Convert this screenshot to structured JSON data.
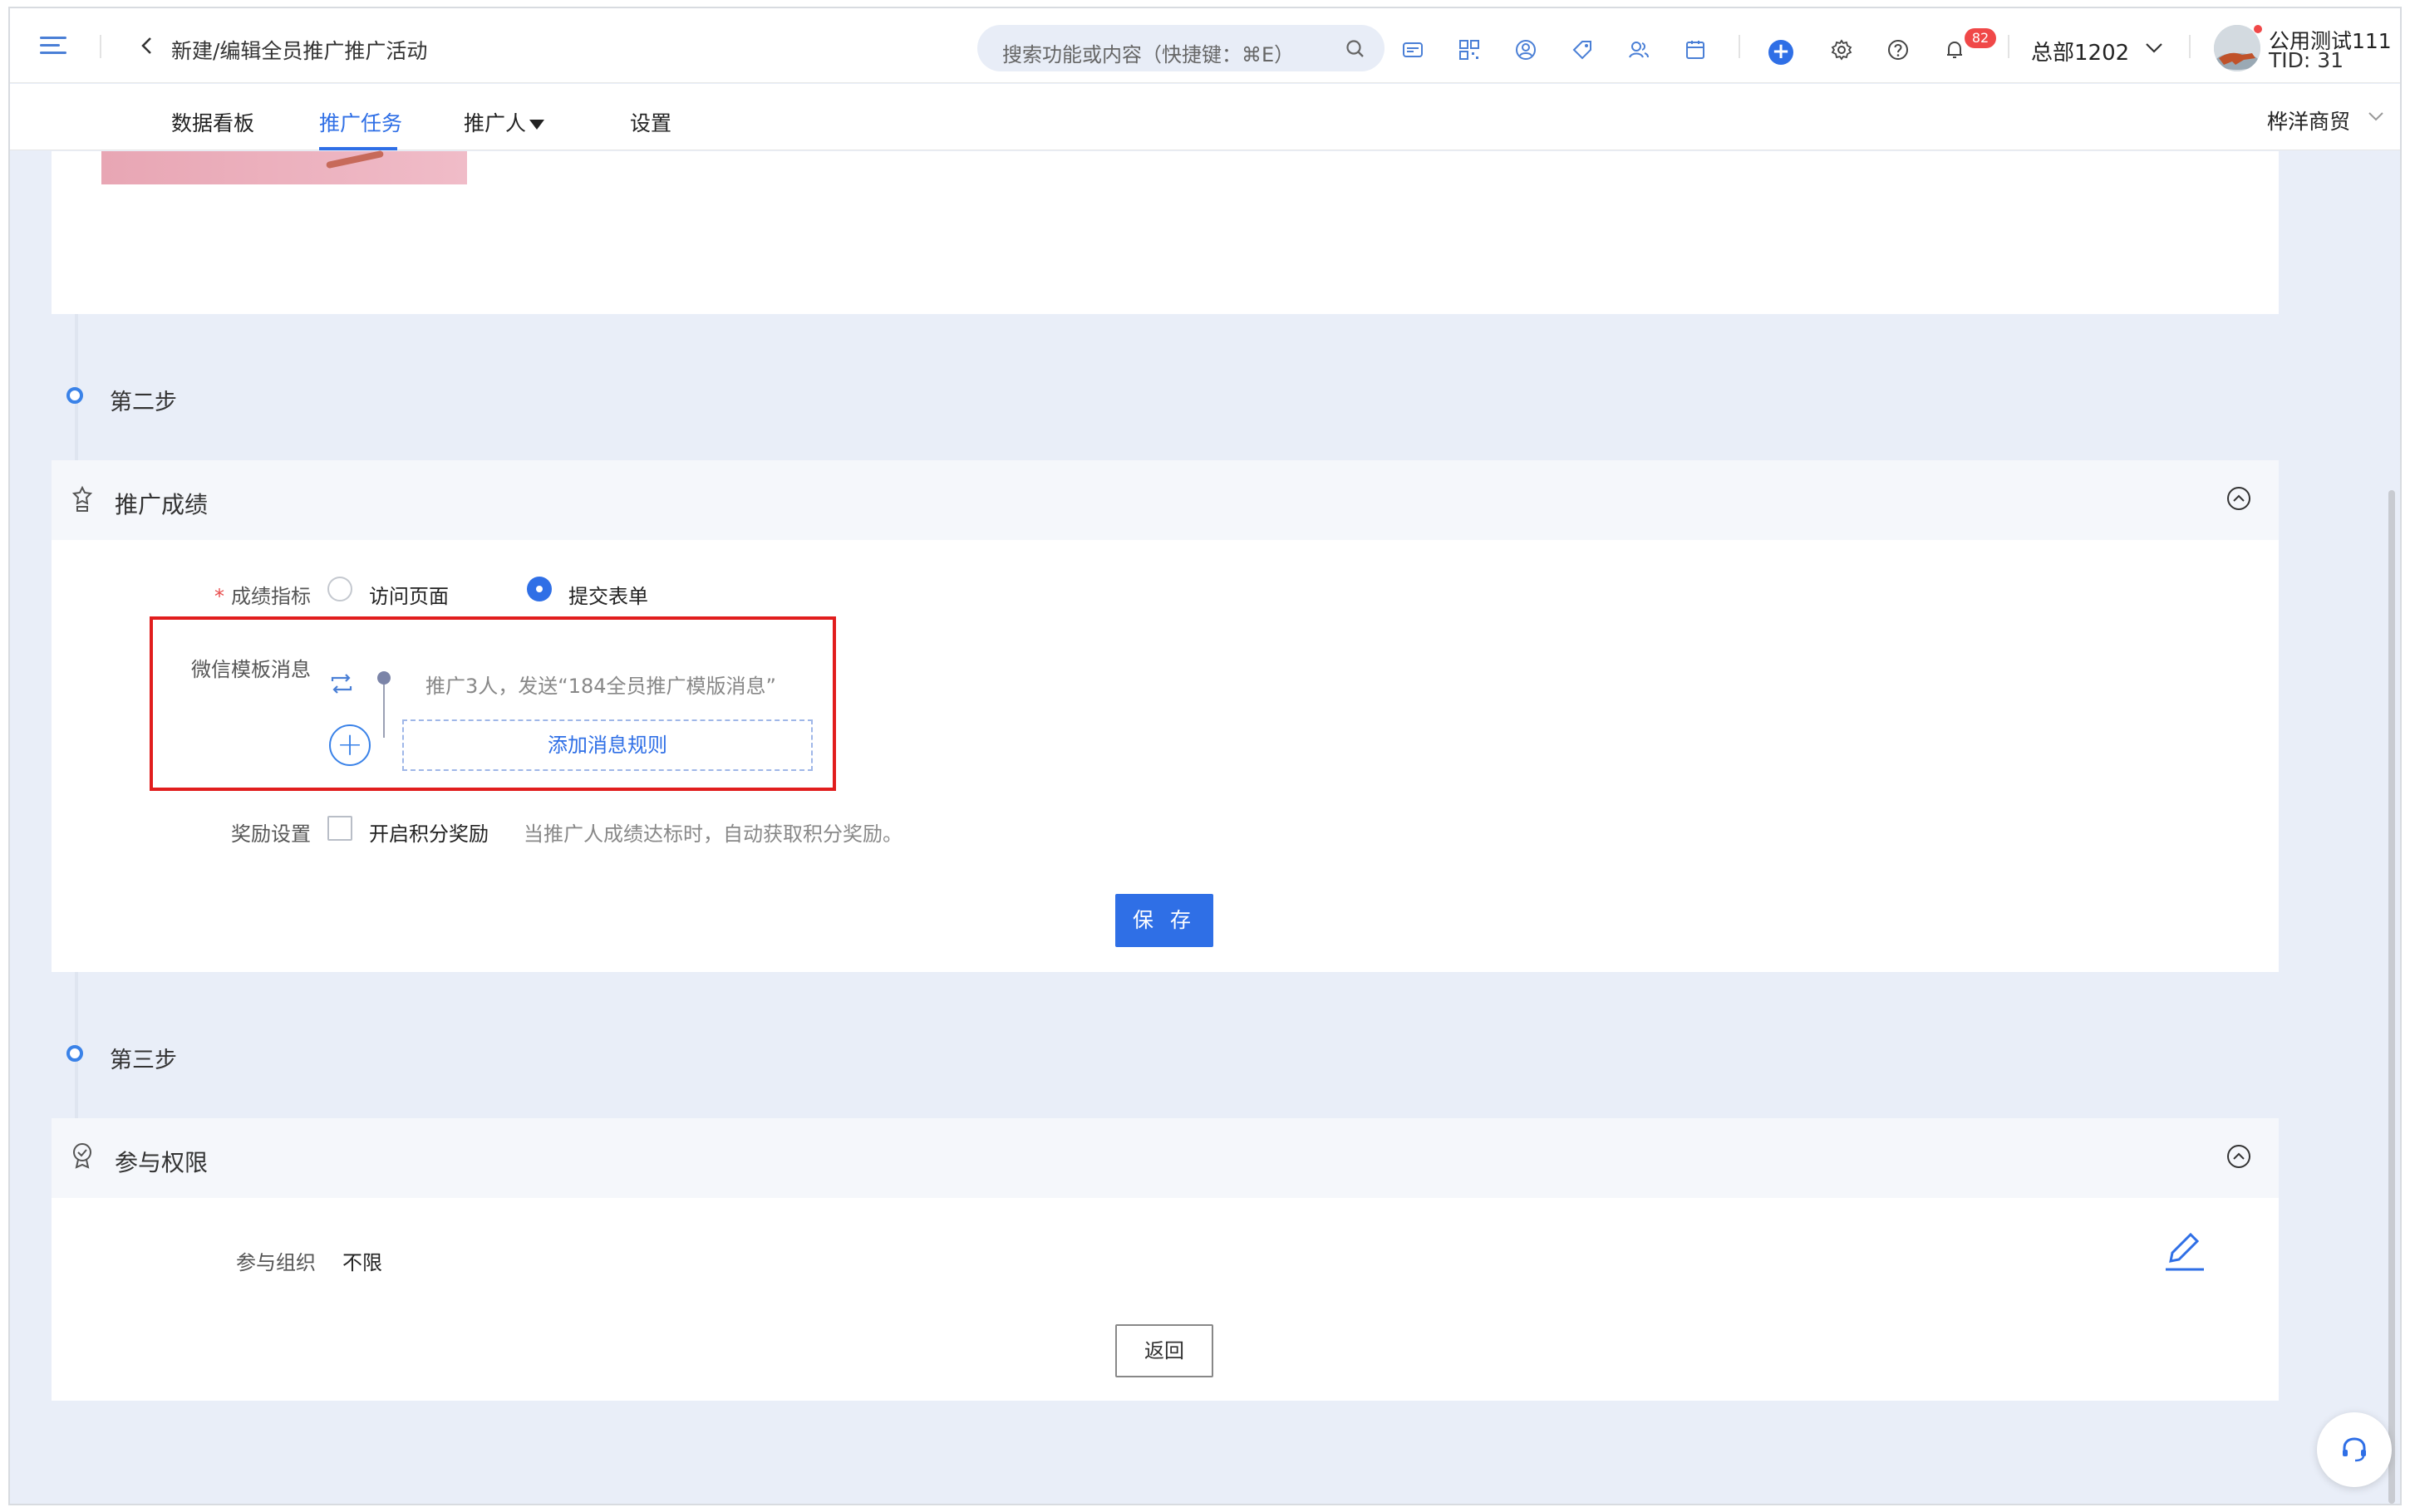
{
  "header": {
    "title": "新建/编辑全员推广推广活动",
    "search_placeholder": "搜索功能或内容（快捷键：⌘E）",
    "notification_count": "82",
    "org_name": "总部1202",
    "user_name": "公用测试111",
    "user_tid": "TID: 31"
  },
  "tabs": [
    {
      "label": "数据看板"
    },
    {
      "label": "推广任务"
    },
    {
      "label": "推广人"
    },
    {
      "label": "设置"
    }
  ],
  "company": "桦洋商贸",
  "step2": {
    "label": "第二步",
    "card_title": "推广成绩",
    "metric_label": "成绩指标",
    "metric_options": [
      "访问页面",
      "提交表单"
    ],
    "metric_selected": "提交表单",
    "wechat_label": "微信模板消息",
    "rule_text": "推广3人，发送“184全员推广模版消息”",
    "add_rule_label": "添加消息规则",
    "reward_label": "奖励设置",
    "reward_checkbox_label": "开启积分奖励",
    "reward_hint": "当推广人成绩达标时，自动获取积分奖励。",
    "save_label": "保 存"
  },
  "step3": {
    "label": "第三步",
    "card_title": "参与权限",
    "org_label": "参与组织",
    "org_value": "不限",
    "back_label": "返回"
  },
  "colors": {
    "accent": "#2f6fe6",
    "highlight_border": "#e11d1d",
    "page_bg": "#e9eef8"
  }
}
